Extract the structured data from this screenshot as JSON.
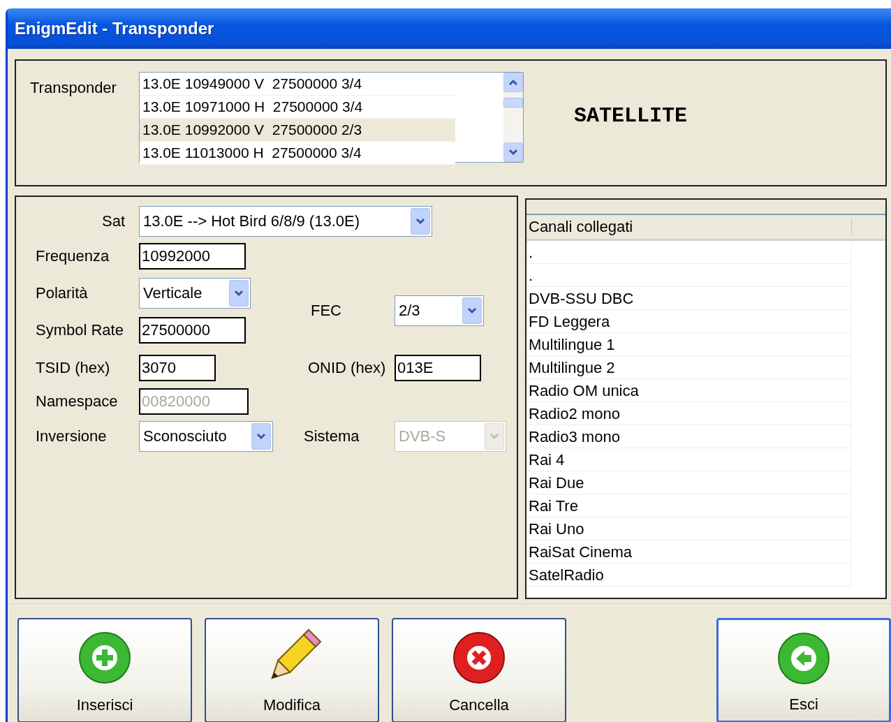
{
  "window": {
    "title": "EnigmEdit - Transponder"
  },
  "transponder": {
    "label": "Transponder",
    "rows": [
      {
        "text": "13.0E 10949000 V  27500000 3/4",
        "selected": false
      },
      {
        "text": "13.0E 10971000 H  27500000 3/4",
        "selected": false
      },
      {
        "text": "13.0E 10992000 V  27500000 2/3",
        "selected": true
      },
      {
        "text": "13.0E 11013000 H  27500000 3/4",
        "selected": false
      }
    ]
  },
  "type_label": "SATELLITE",
  "form": {
    "fields": [
      {
        "label": "Sat",
        "kind": "select",
        "value": "13.0E --> Hot Bird 6/8/9 (13.0E)",
        "disabled": false
      },
      {
        "label": "Frequenza",
        "kind": "text",
        "value": "10992000",
        "disabled": false
      },
      {
        "label": "Polarità",
        "kind": "select",
        "value": "Verticale",
        "disabled": false
      },
      {
        "label": "FEC",
        "kind": "select",
        "value": "2/3",
        "disabled": false
      },
      {
        "label": "Symbol Rate",
        "kind": "text",
        "value": "27500000",
        "disabled": false
      },
      {
        "label": "TSID (hex)",
        "kind": "text",
        "value": "3070",
        "disabled": false
      },
      {
        "label": "ONID (hex)",
        "kind": "text",
        "value": "013E",
        "disabled": false
      },
      {
        "label": "Namespace",
        "kind": "text",
        "value": "00820000",
        "disabled": true
      },
      {
        "label": "Inversione",
        "kind": "select",
        "value": "Sconosciuto",
        "disabled": false
      },
      {
        "label": "Sistema",
        "kind": "select",
        "value": "DVB-S",
        "disabled": true
      }
    ]
  },
  "channels": {
    "header": "Canali collegati",
    "rows": [
      ".",
      ".",
      "DVB-SSU DBC",
      "FD Leggera",
      "Multilingue 1",
      "Multilingue 2",
      "Radio OM unica",
      "Radio2 mono",
      "Radio3 mono",
      "Rai 4",
      "Rai Due",
      "Rai Tre",
      "Rai Uno",
      "RaiSat Cinema",
      "SatelRadio"
    ]
  },
  "buttons": [
    {
      "label": "Inserisci",
      "kind": "add"
    },
    {
      "label": "Modifica",
      "kind": "edit"
    },
    {
      "label": "Cancella",
      "kind": "delete"
    },
    {
      "label": "Esci",
      "kind": "exit"
    }
  ]
}
